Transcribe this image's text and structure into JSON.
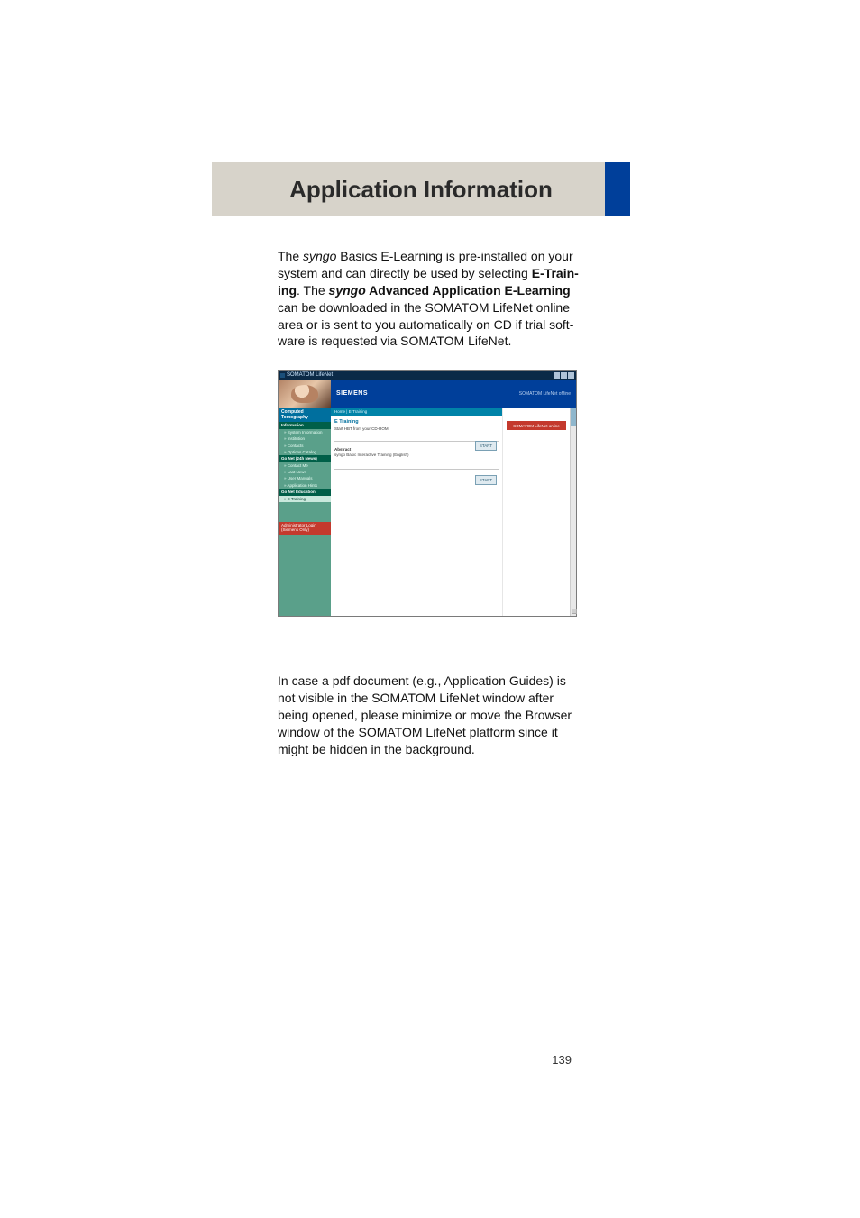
{
  "header": {
    "title": "Application Information"
  },
  "para1": {
    "t1": "The ",
    "i1": "syngo",
    "t2": " Basics E-Learning is pre-installed on your system and can directly be used by selecting ",
    "b1": "E-Train­ing",
    "t3": ". The ",
    "bi": "syngo",
    "b2": " Advanced Application E-Learning",
    "t4": " can be downloaded in the SOMATOM LifeNet online area or is sent to you automatically on CD if trial soft­ware is requested via SOMATOM LifeNet."
  },
  "screenshot": {
    "window_title": "SOMATOM LifeNet",
    "brand": "SIEMENS",
    "brand_sub": "SOMATOM LifeNet offline",
    "sidebar_header": "Computed\nTomography",
    "section_info": "Information",
    "info_items": [
      "» System Information",
      "» Institution",
      "» Contacts",
      "» Options Catalog"
    ],
    "section_quick": "Go Net (24h News)",
    "quick_items": [
      "» Contact Me",
      "» Last News",
      "» User Manuals",
      "» Application Hints"
    ],
    "section_edu": "Go Net Education",
    "edu_item": "» E Training",
    "admin": "Administrator Login\n(Siemens Only)",
    "breadcrumb": "Home  |  E-Training",
    "h_etraining": "E Training",
    "line_cd": "Start HBT from your CD-ROM",
    "sub_head": "Abstract",
    "sub_text": "syngo Basic Interactive Training (English)",
    "start": "START",
    "red_btn": "SOMATOM LifeNet online"
  },
  "para2": "In case a pdf document (e.g., Application Guides) is not visible in the SOMATOM LifeNet window after being opened, please minimize or move the Browser window of the SOMATOM LifeNet platform since it might be hidden in the background.",
  "page_number": "139"
}
